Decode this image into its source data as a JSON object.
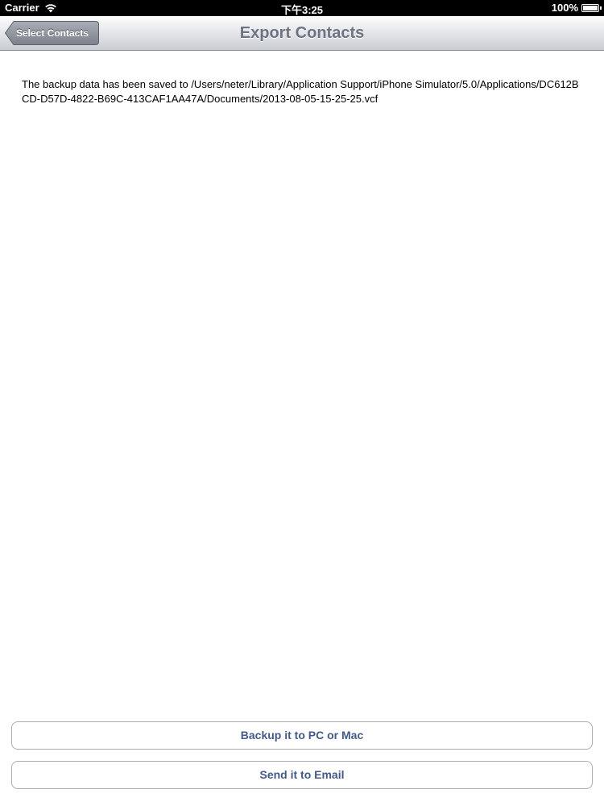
{
  "status_bar": {
    "carrier": "Carrier",
    "time": "下午3:25",
    "battery_percent": "100%",
    "battery_level": 1.0
  },
  "nav_bar": {
    "back_button_label": "Select Contacts",
    "title": "Export Contacts"
  },
  "content": {
    "message": "The backup data has been saved to /Users/neter/Library/Application Support/iPhone Simulator/5.0/Applications/DC612BCD-D57D-4822-B69C-413CAF1AA47A/Documents/2013-08-05-15-25-25.vcf"
  },
  "actions": {
    "backup_label": "Backup it to PC or Mac",
    "email_label": "Send it to Email"
  },
  "colors": {
    "button_text": "#435a86",
    "nav_title": "#6d7380",
    "back_button": "#8d929d"
  }
}
